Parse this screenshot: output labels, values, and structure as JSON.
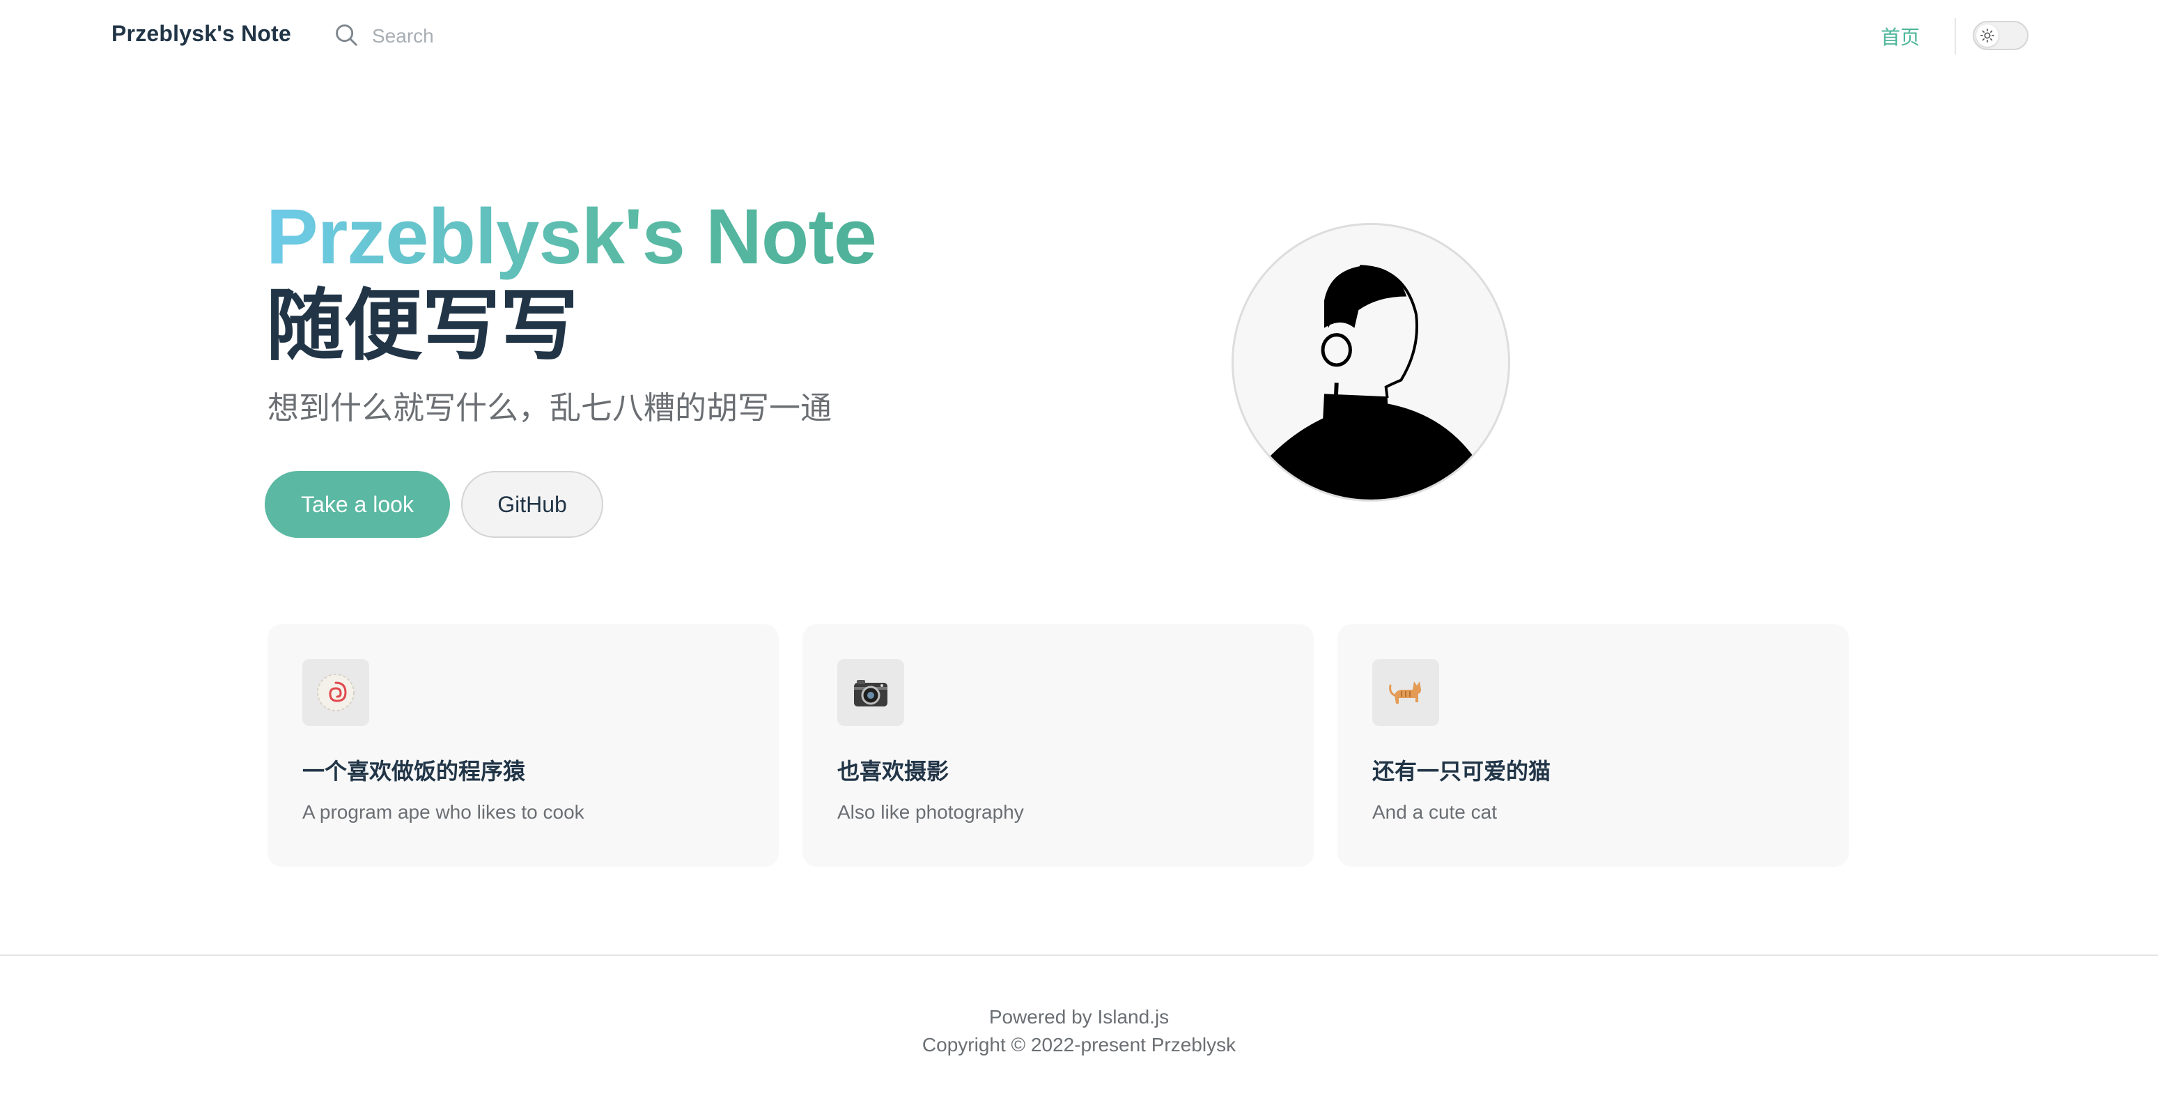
{
  "nav": {
    "brand": "Przeblysk's Note",
    "search_placeholder": "Search",
    "links": [
      {
        "label": "首页"
      }
    ],
    "theme": "light"
  },
  "hero": {
    "name": "Przeblysk's Note",
    "text": "随便写写",
    "tagline": "想到什么就写什么，乱七八糟的胡写一通",
    "actions": [
      {
        "label": "Take a look",
        "theme": "brand"
      },
      {
        "label": "GitHub",
        "theme": "alt"
      }
    ],
    "image": "avatar-silhouette"
  },
  "features": [
    {
      "icon": "fish-cake-icon",
      "title": "一个喜欢做饭的程序猿",
      "details": "A program ape who likes to cook"
    },
    {
      "icon": "camera-icon",
      "title": "也喜欢摄影",
      "details": "Also like photography"
    },
    {
      "icon": "cat-icon",
      "title": "还有一只可爱的猫",
      "details": "And a cute cat"
    }
  ],
  "footer": {
    "message": "Powered by Island.js",
    "copyright": "Copyright © 2022-present Przeblysk"
  },
  "colors": {
    "brand": "#5bb8a2",
    "brand_link": "#4bb59a",
    "gradient_start": "#6ecbe8",
    "gradient_end": "#4eb198",
    "text": "#213547",
    "muted": "#6b6f73"
  }
}
